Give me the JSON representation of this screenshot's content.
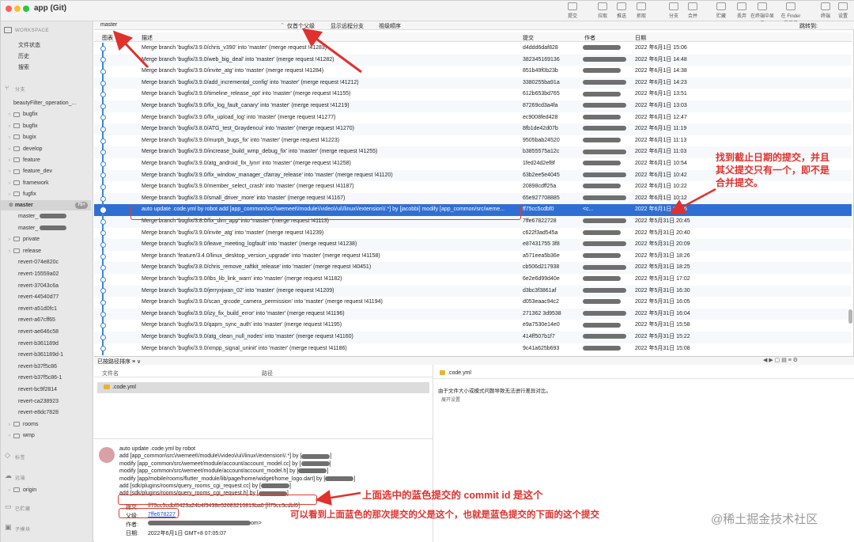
{
  "toolbar": {
    "title": "app (Git)",
    "buttons": [
      "提交",
      "拉取",
      "推送",
      "抓取",
      "分支",
      "合并",
      "贮藏",
      "丢弃",
      "在终端中显示",
      "在 Finder 中显示",
      "终端",
      "设置"
    ]
  },
  "sidebar": {
    "workspace_heading": "WORKSPACE",
    "workspace_items": [
      "文件状态",
      "历史",
      "搜索"
    ],
    "branches_heading": "分支",
    "branch_items": [
      "beautyFilter_operation_...",
      "bugfix",
      "bugfix",
      "bugix",
      "develop",
      "feature",
      "feature_dev",
      "framework",
      "fugfix"
    ],
    "current_branch": "master",
    "current_badge": "75+",
    "extra_items": [
      "master_",
      "master_",
      "private",
      "release",
      "revert-074e820c",
      "revert-15559a02",
      "revert-37043c6a",
      "revert-44540d77",
      "revert-a51d0fc1",
      "revert-a67cff65",
      "revert-ae646c58",
      "revert-b361189d",
      "revert-b361189d-1",
      "revert-b37f5c86",
      "revert-b37f5c86-1",
      "revert-bc9f2814",
      "revert-ca238923",
      "revert-e8dc7828",
      "rooms",
      "wmp"
    ],
    "tags_heading": "标签",
    "remotes_heading": "远端",
    "remote_origin": "origin",
    "stash_heading": "已贮藏",
    "submodule_heading": "子模块"
  },
  "filter_bar": {
    "branch": "master",
    "parent_mode": "仅首个父级",
    "remote": "显示远程分支",
    "order": "祖级顺序",
    "jump": "跳转到:"
  },
  "table": {
    "headers": [
      "图表",
      "描述",
      "提交",
      "作者",
      "日期"
    ],
    "rows": [
      {
        "desc": "Merge branch 'bugfix/3.9.0/chris_v390' into 'master' (merge request !41283)",
        "hash": "d4ddd6daf828",
        "date": "2022 年6月1日 15:06"
      },
      {
        "desc": "Merge branch 'bugfix/3.9.0/web_big_deal' into 'master' (merge request !41282)",
        "hash": "382345169136",
        "date": "2022 年6月1日 14:48"
      },
      {
        "desc": "Merge branch 'bugfix/3.9.0/invite_atg' into 'master' (merge request !41284)",
        "hash": "851b49f0b23b",
        "date": "2022 年6月1日 14:38"
      },
      {
        "desc": "Merge branch 'bugfix/3.9.0/add_incremental_config' into 'master' (merge request !41212)",
        "hash": "3380255ba91a",
        "date": "2022 年6月1日 14:23"
      },
      {
        "desc": "Merge branch 'bugfix/3.9.0/timeline_release_opt' into 'master' (merge request !41155)",
        "hash": "612b653bd765",
        "date": "2022 年6月1日 13:51"
      },
      {
        "desc": "Merge branch 'bugfix/3.9.0/fix_log_fault_canary' into 'master' (merge request !41219)",
        "hash": "87269cd3a4fa",
        "date": "2022 年6月1日 13:03"
      },
      {
        "desc": "Merge branch 'bugfix/3.9.0/fix_upload_log' into 'master' (merge request !41277)",
        "hash": "ec9008fed428",
        "date": "2022 年6月1日 12:47"
      },
      {
        "desc": "Merge branch 'bugfix/3.8.0/ATG_test_Graydencui' into 'master' (merge request !41270)",
        "hash": "8fb1de42d07b",
        "date": "2022 年6月1日 11:19"
      },
      {
        "desc": "Merge branch 'bugfix/3.9.0/murph_bugs_fix' into 'master' (merge request !41223)",
        "hash": "9505bab24520",
        "date": "2022 年6月1日 11:13"
      },
      {
        "desc": "Merge branch 'bugfix/3.9.0/increase_build_wmp_debug_fix' into 'master' (merge request !41255)",
        "hash": "b3855575a12c",
        "date": "2022 年6月1日 11:03"
      },
      {
        "desc": "Merge branch 'bugfix/3.9.0/atg_android_fix_lynn' into 'master' (merge request !41258)",
        "hash": "1fed24d2ef8f",
        "date": "2022 年6月1日 10:54"
      },
      {
        "desc": "Merge branch 'bugfix/3.9.0/fix_window_manager_cfarray_release' into 'master' (merge request !41120)",
        "hash": "63b2ee5e4045",
        "date": "2022 年6月1日 10:42"
      },
      {
        "desc": "Merge branch 'bugfix/3.9.0/member_select_crash' into 'master' (merge request !41187)",
        "hash": "20898cdff25a",
        "date": "2022 年6月1日 10:22"
      },
      {
        "desc": "Merge branch 'bugfix/3.9.0/small_driver_more' into 'master' (merge request !41167)",
        "hash": "65e927708885",
        "date": "2022 年6月1日 10:12"
      },
      {
        "desc": "auto update .code.yml by robot add [app_common/src/\\wemeet\\/module\\/video\\/ui\\/linux\\/extension\\/.*] by [jacobbi] modify [app_common/src/weme...",
        "hash": "ff75cc5cdbf0",
        "author": "<c...",
        "date": "2022 年6月1日 07:05",
        "selected": true
      },
      {
        "desc": "Merge branch 'bugfix/3.8.0/fix_dim_app' into 'master' (merge request !41113)",
        "hash": "7ffe67822728",
        "date": "2022 年5月31日 20:45"
      },
      {
        "desc": "Merge branch 'bugfix/3.9.0/invite_atg' into 'master' (merge request !41239)",
        "hash": "c622f3ad545a",
        "date": "2022 年5月31日 20:40"
      },
      {
        "desc": "Merge branch 'bugfix/3.9.0/leave_meeting_logfault' into 'master' (merge request !41238)",
        "hash": "e87431755 3f8",
        "date": "2022 年5月31日 20:09"
      },
      {
        "desc": "Merge branch 'feature/3.4.0/linux_desktop_version_upgrade' into 'master' (merge request !41158)",
        "hash": "a571eea5b36e",
        "date": "2022 年5月31日 18:26"
      },
      {
        "desc": "Merge branch 'bugfix/3.8.0/chris_remove_raftkit_release' into 'master' (merge request !40451)",
        "hash": "cb506d217938",
        "date": "2022 年5月31日 18:25"
      },
      {
        "desc": "Merge branch 'bugfix/3.9.0/tbs_lib_link_warn' into 'master' (merge request !41182)",
        "hash": "6e2e6d99d40e",
        "date": "2022 年5月31日 17:02"
      },
      {
        "desc": "Merge branch 'bugfix/3.9.0/jerryxjwan_02' into 'master' (merge request !41209)",
        "hash": "d3bc3f3861af",
        "date": "2022 年5月31日 16:30"
      },
      {
        "desc": "Merge branch 'bugfix/3.9.0/scan_qrcode_camera_permission' into 'master' (merge request !41194)",
        "hash": "d053eaac94c2",
        "date": "2022 年5月31日 16:05"
      },
      {
        "desc": "Merge branch 'bugfix/3.9.0/izy_fix_build_error' into 'master' (merge request !41196)",
        "hash": "271362 3d9538",
        "date": "2022 年5月31日 16:04"
      },
      {
        "desc": "Merge branch 'bugfix/3.9.0/qapm_sync_auth' into 'master' (merge request !41195)",
        "hash": "e9a7530e14e0",
        "date": "2022 年5月31日 15:58"
      },
      {
        "desc": "Merge branch 'bugfix/3.9.0/atg_clean_null_nodes' into 'master' (merge request !41160)",
        "hash": "414ff507b1f7",
        "date": "2022 年5月31日 15:22"
      },
      {
        "desc": "Merge branch 'bugfix/3.9.0/xmpp_signal_uninit' into 'master' (merge request !41186)",
        "hash": "9c41a625b693",
        "date": "2022 年5月31日 15:08"
      }
    ]
  },
  "sort_bar": {
    "label": "已按路径排序 ≡ ∨"
  },
  "files": {
    "headers": [
      "文件名",
      "路径"
    ],
    "items": [
      ".code.yml"
    ]
  },
  "diff": {
    "file": ".code.yml",
    "notice": "由于文件大小或模式问题导致无法进行差异对比。",
    "show": "展开设置"
  },
  "commit_detail": {
    "message": [
      "auto update .code.yml by robot",
      "add [app_common\\src\\/wemeet\\/module\\/video\\/ui\\/linux\\/extension\\/.*] by [",
      "modify [app_common/src/wemeet/module/account/account_model.cc] by [",
      "modify [app_common/src/wemeet/module/account/account_model.h] by [",
      "modify [app/mobile/rooms/flutter_module/lib/page/home/widget/home_logo.dart] by [",
      "add [sdk/plugins/rooms/query_rooms_cgi_request.cc] by [",
      "add [sdk/plugins/rooms/query_rooms_cgi_request.h] by ["
    ],
    "commit_label": "提交:",
    "commit_value": "ff75cc5cdbf0423a24b4f5438e52683210813ba0 [ff75cc5cdbf0]",
    "parent_label": "父级:",
    "parent_value": "7ffe678227",
    "author_label": "作者:",
    "author_suffix": "om>",
    "date_label": "日期:",
    "date_value": "2022年6月1日 GMT+8 07:05:07"
  },
  "annotations": {
    "right": "找到截止日期的提交，并且其父提交只有一个，即不是合并提交。",
    "right_lines": [
      "找到截止日期的提交，并且",
      "其父提交只有一个，即不是",
      "合并提交。"
    ],
    "commit_id": "上面选中的蓝色提交的 commit id 是这个",
    "parent": "可以看到上面蓝色的那次提交的父是这个，也就是蓝色提交的下面的这个提交",
    "watermark": "@稀土掘金技术社区"
  },
  "colors": {
    "selection": "#2f6fd3",
    "annotation": "#e0312d",
    "graph": "#3a86d8"
  }
}
